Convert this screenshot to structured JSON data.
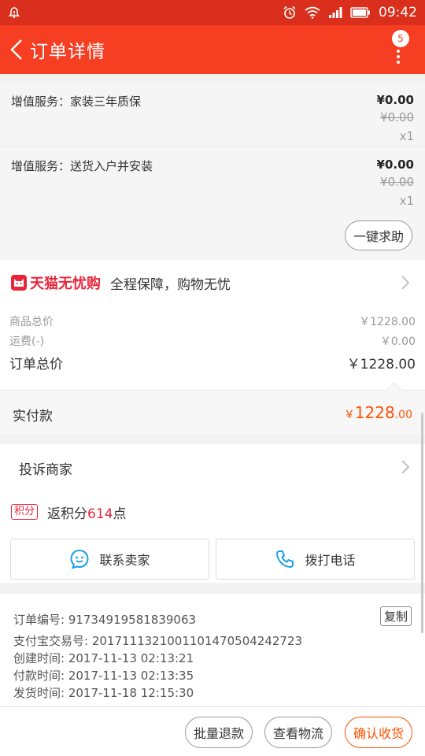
{
  "status_bar": {
    "time": "09:42",
    "icons": [
      "notification-bell-icon",
      "alarm-icon",
      "wifi-icon",
      "signal-icon",
      "battery-icon"
    ]
  },
  "header": {
    "title": "订单详情",
    "more_badge": "5"
  },
  "services": [
    {
      "name": "增值服务：家装三年质保",
      "price": "¥0.00",
      "original_price": "¥0.00",
      "qty": "x1"
    },
    {
      "name": "增值服务：送货入户并安装",
      "price": "¥0.00",
      "original_price": "¥0.00",
      "qty": "x1"
    }
  ],
  "help_button": "一键求助",
  "guarantee": {
    "brand": "天猫无忧购",
    "text": "全程保障，购物无忧"
  },
  "summary": {
    "goods_label": "商品总价",
    "goods_value": "￥1228.00",
    "shipping_label": "运费(-)",
    "shipping_value": "￥0.00",
    "total_label": "订单总价",
    "total_value": "￥1228.00"
  },
  "paid": {
    "label": "实付款",
    "currency": "￥",
    "integer": "1228",
    "decimal": ".00"
  },
  "complain": {
    "label": "投诉商家"
  },
  "points": {
    "tag": "积分",
    "prefix": "返积分",
    "value": "614",
    "suffix": "点"
  },
  "contacts": {
    "seller_label": "联系卖家",
    "phone_label": "拨打电话"
  },
  "order_info": {
    "order_no": "订单编号: 91734919581839063",
    "copy_label": "复制",
    "alipay_no": "支付宝交易号: 2017111321001101470504242723",
    "created": "创建时间: 2017-11-13 02:13:21",
    "paid_time": "付款时间: 2017-11-13 02:13:35",
    "shipped": "发货时间: 2017-11-18 12:15:30"
  },
  "bottom_bar": {
    "refund": "批量退款",
    "logistics": "查看物流",
    "confirm": "确认收货"
  },
  "colors": {
    "header": "#f63e22",
    "status_bar": "#d92f1c",
    "accent": "#ff5000",
    "tmall_red": "#e8263a"
  }
}
